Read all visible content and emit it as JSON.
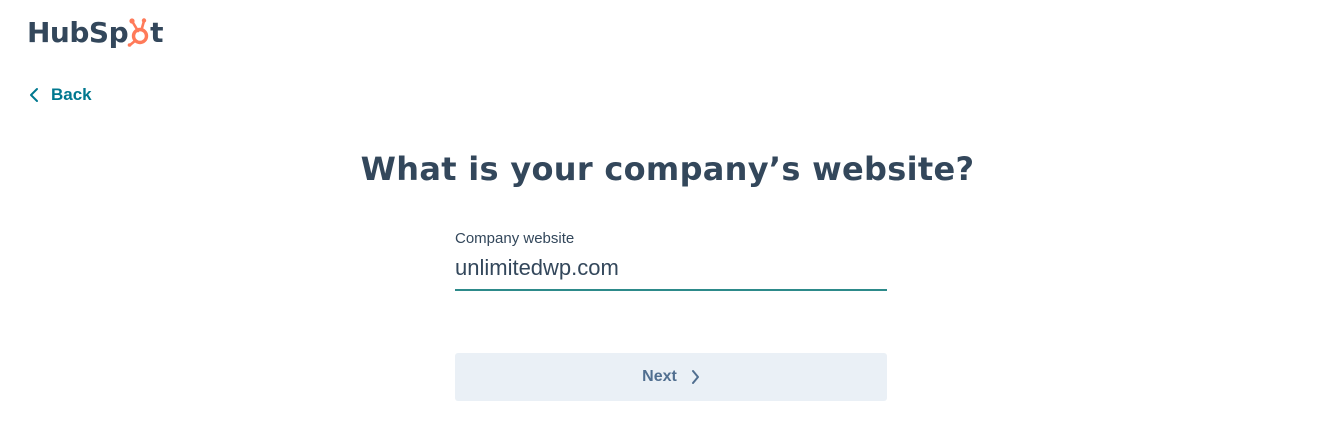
{
  "brand": {
    "name_prefix": "HubSp",
    "name_suffix": "t",
    "accent_color": "#ff7a59",
    "logo_icon": "hubspot-sprocket-icon"
  },
  "nav": {
    "back_label": "Back",
    "back_icon": "chevron-left-icon",
    "link_color": "#00788f"
  },
  "main": {
    "heading": "What is your company’s website?",
    "field": {
      "label": "Company website",
      "value": "unlimitedwp.com",
      "underline_color": "#2d8a8a"
    },
    "next_button": {
      "label": "Next",
      "icon": "chevron-right-icon",
      "background": "#eaf0f6"
    }
  }
}
